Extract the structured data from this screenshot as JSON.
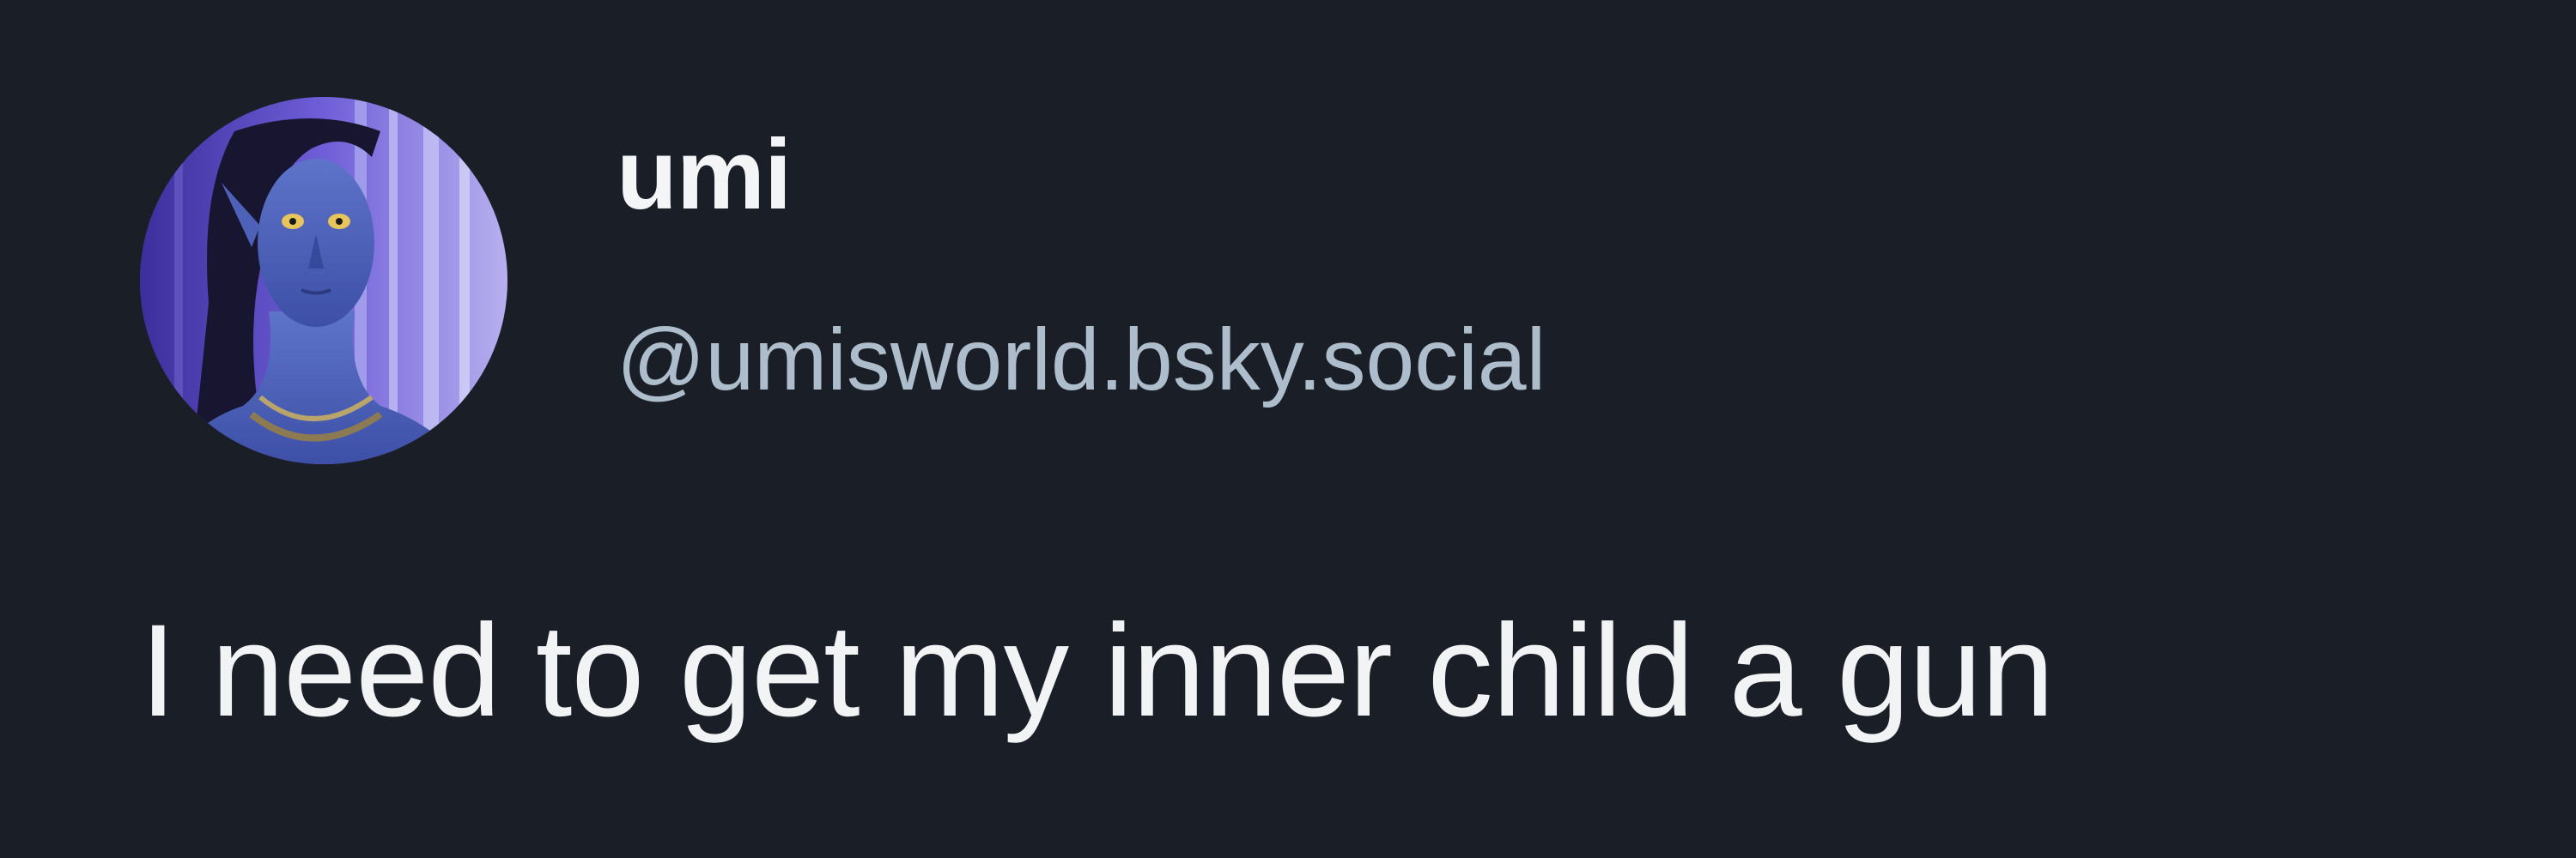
{
  "post": {
    "author": {
      "display_name": "umi",
      "handle": "@umisworld.bsky.social",
      "avatar_icon": "avatar-navi-portrait"
    },
    "text": "I need to get my inner child a gun"
  },
  "colors": {
    "background": "#1a1f27",
    "primary_text": "#f1f3f5",
    "secondary_text": "#aebdcc"
  }
}
